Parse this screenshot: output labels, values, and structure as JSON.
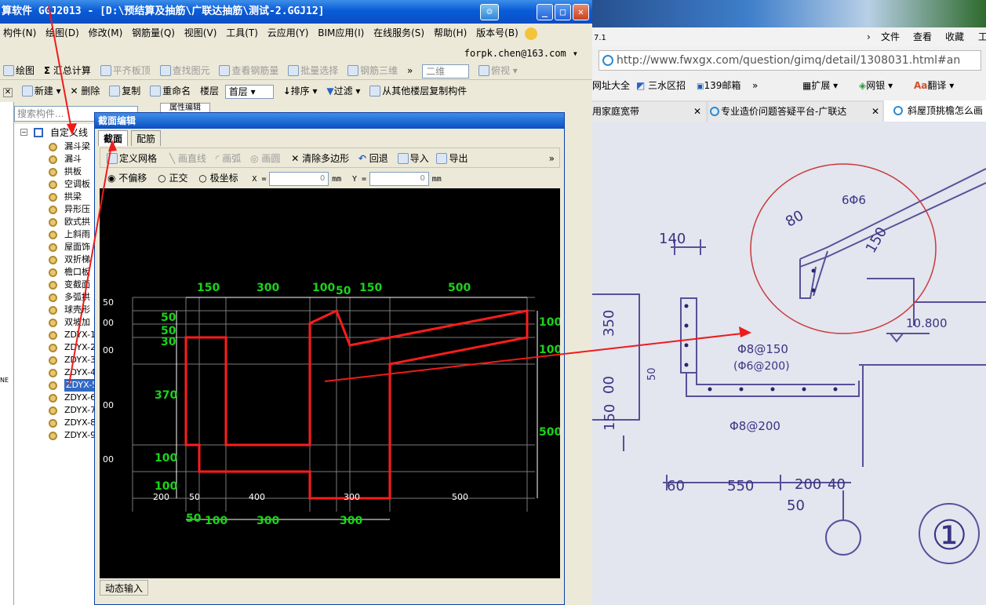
{
  "app": {
    "title": "算软件 GGJ2013 - [D:\\预结算及抽筋\\广联达抽筋\\测试-2.GGJ12]",
    "menu": [
      "构件(N)",
      "绘图(D)",
      "修改(M)",
      "钢筋量(Q)",
      "视图(V)",
      "工具(T)",
      "云应用(Y)",
      "BIM应用(I)",
      "在线服务(S)",
      "帮助(H)",
      "版本号(B)"
    ],
    "account": "forpk.chen@163.com",
    "toolbar1": [
      "绘图",
      "汇总计算",
      "平齐板顶",
      "查找图元",
      "查看钢筋量",
      "批量选择",
      "钢筋三维"
    ],
    "view_mode": "二维",
    "view_angle": "俯视",
    "toolbar2": {
      "new": "新建",
      "delete": "删除",
      "copy": "复制",
      "rename": "重命名",
      "floor_label": "楼层",
      "floor_value": "首层",
      "sort": "排序",
      "filter": "过滤",
      "copy_from": "从其他楼层复制构件"
    },
    "search_placeholder": "搜索构件...",
    "prop_tab": "属性编辑",
    "tree_root": "自定义线",
    "tree_items": [
      "漏斗梁",
      "漏斗",
      "拱板",
      "空调板",
      "拱梁",
      "异形压",
      "欧式拱",
      "上斜雨",
      "屋面饰",
      "双折梯",
      "檐口板",
      "变截面",
      "多弧拱",
      "球壳形",
      "双坡加",
      "ZDYX-1",
      "ZDYX-2",
      "ZDYX-3",
      "ZDYX-4",
      "ZDYX-5",
      "ZDYX-6",
      "ZDYX-7",
      "ZDYX-8",
      "ZDYX-9"
    ],
    "selected_item": "ZDYX-5",
    "left_edge_text": "NE"
  },
  "dialog": {
    "title": "截面编辑",
    "tabs": [
      "截面",
      "配筋"
    ],
    "tools": {
      "grid": "定义网格",
      "line": "画直线",
      "arc": "画弧",
      "circle": "画圆",
      "clear": "清除多边形",
      "undo": "回退",
      "import": "导入",
      "export": "导出"
    },
    "options": {
      "no_offset": "不偏移",
      "ortho": "正交",
      "polar": "极坐标",
      "x_label": "X =",
      "y_label": "Y =",
      "x_value": "0",
      "y_value": "0",
      "unit": "mm"
    },
    "status": "动态输入",
    "top_dims": [
      "150",
      "300",
      "100",
      "50",
      "150",
      "500"
    ],
    "left_dims": [
      "50",
      "50",
      "30",
      "370",
      "100",
      "100"
    ],
    "right_dims": [
      "100",
      "100",
      "500"
    ],
    "bottom_dims": [
      "50",
      "100",
      "300",
      "300"
    ],
    "grid_bottom_labels": [
      "200",
      "50",
      "400",
      "300",
      "500"
    ],
    "grid_left_labels": [
      "50",
      "00",
      "00",
      "00",
      "00"
    ]
  },
  "browser": {
    "version_text": "7.1",
    "menu": [
      "文件",
      "查看",
      "收藏",
      "工"
    ],
    "url": "http://www.fwxgx.com/question/gimq/detail/1308031.html#an",
    "bookmarks": [
      "网址大全",
      "三水区招",
      "139邮箱",
      "扩展",
      "网银",
      "翻译"
    ],
    "tabs": [
      "用家庭宽带",
      "专业造价问题答疑平台-广联达",
      "斜屋顶挑檐怎么画"
    ]
  },
  "drawing": {
    "labels": [
      "140",
      "6Φ6",
      "80",
      "150",
      "350",
      "10.800",
      "Φ8@150",
      "(Φ6@200)",
      "Φ8@200",
      "00",
      "150",
      "50",
      "60",
      "550",
      "200",
      "40",
      "50",
      "①"
    ]
  }
}
